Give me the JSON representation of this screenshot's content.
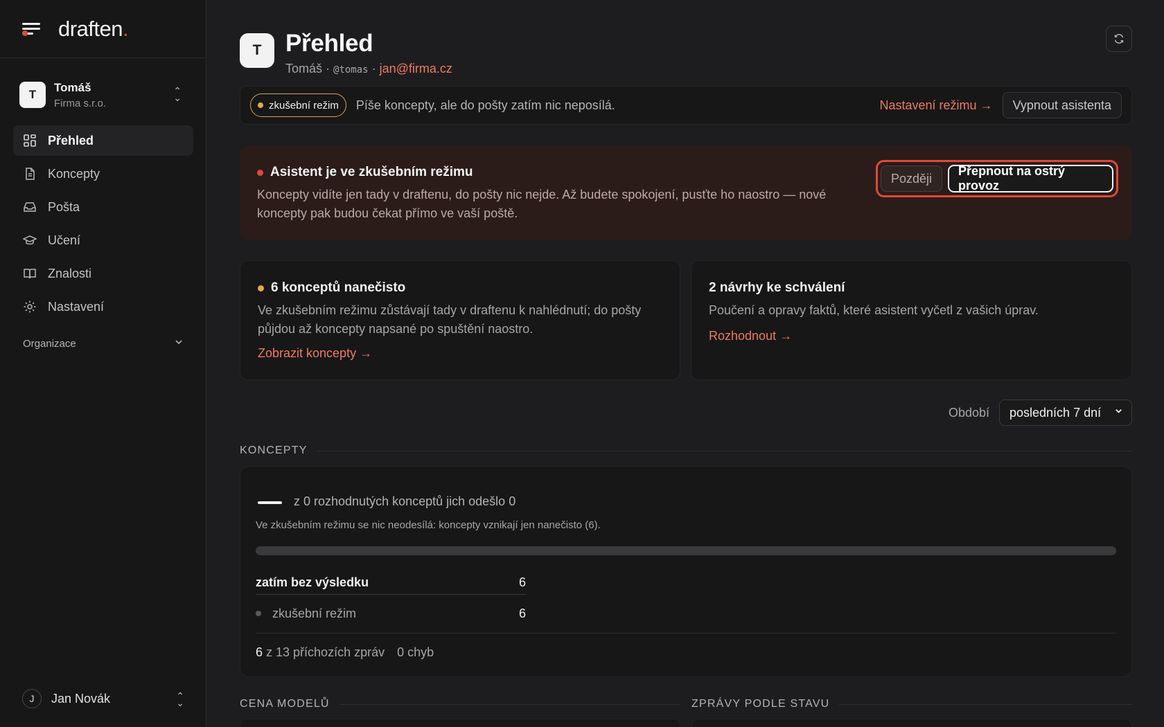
{
  "app": {
    "logo": "draften",
    "logo_dot": "."
  },
  "org": {
    "initial": "T",
    "name": "Tomáš",
    "company": "Firma s.r.o."
  },
  "nav": [
    {
      "label": "Přehled",
      "icon": "dashboard-icon",
      "active": true
    },
    {
      "label": "Koncepty",
      "icon": "document-icon"
    },
    {
      "label": "Pošta",
      "icon": "inbox-icon"
    },
    {
      "label": "Učení",
      "icon": "graduation-cap-icon"
    },
    {
      "label": "Znalosti",
      "icon": "book-icon"
    },
    {
      "label": "Nastavení",
      "icon": "gear-icon"
    }
  ],
  "sidebar_section": {
    "label": "Organizace"
  },
  "user": {
    "initial": "J",
    "name": "Jan Novák"
  },
  "header": {
    "avatar": "T",
    "title": "Přehled",
    "name": "Tomáš",
    "sep1": " · ",
    "handle": "@tomas",
    "sep2": " · ",
    "email": "jan@firma.cz"
  },
  "mode_bar": {
    "badge": "zkušební režim",
    "description": "Píše koncepty, ale do pošty zatím nic neposílá.",
    "settings_link": "Nastavení režimu →",
    "disable_button": "Vypnout asistenta"
  },
  "alert": {
    "title": "Asistent je ve zkušebním režimu",
    "body": "Koncepty vidíte jen tady v draftenu, do pošty nic nejde. Až budete spokojení, pusťte ho naostro — nové koncepty pak budou čekat přímo ve vaší poště.",
    "later_button": "Později",
    "switch_button": "Přepnout na ostrý provoz"
  },
  "cards": {
    "drafts": {
      "title": "6 konceptů nanečisto",
      "body": "Ve zkušebním režimu zůstávají tady v draftenu k nahlédnutí; do pošty půjdou až koncepty napsané po spuštění naostro.",
      "link": "Zobrazit koncepty →"
    },
    "proposals": {
      "title": "2 návrhy ke schválení",
      "body": "Poučení a opravy faktů, které asistent vyčetl z vašich úprav.",
      "link": "Rozhodnout →"
    }
  },
  "period": {
    "label": "Období",
    "selected": "posledních 7 dní"
  },
  "sections": {
    "drafts": "KONCEPTY",
    "model_cost": "CENA MODELŮ",
    "messages_by_status": "ZPRÁVY PODLE STAVU"
  },
  "drafts_stats": {
    "summary": "z 0 rozhodnutých konceptů jich odešlo 0",
    "note": "Ve zkušebním režimu se nic neodesílá: koncepty vznikají jen nanečisto (6).",
    "progress_fraction": 0,
    "result_label": "zatím bez výsledku",
    "result_value": "6",
    "sub_label": "zkušební režim",
    "sub_value": "6",
    "footer_count": "6",
    "footer_text": " z 13 příchozích zpráv",
    "footer_errors": "0 chyb"
  },
  "colors": {
    "accent": "#ef7a62",
    "alert_red": "#e0483a",
    "trial_amber": "#e3a94a",
    "background": "#1d1d1f"
  }
}
